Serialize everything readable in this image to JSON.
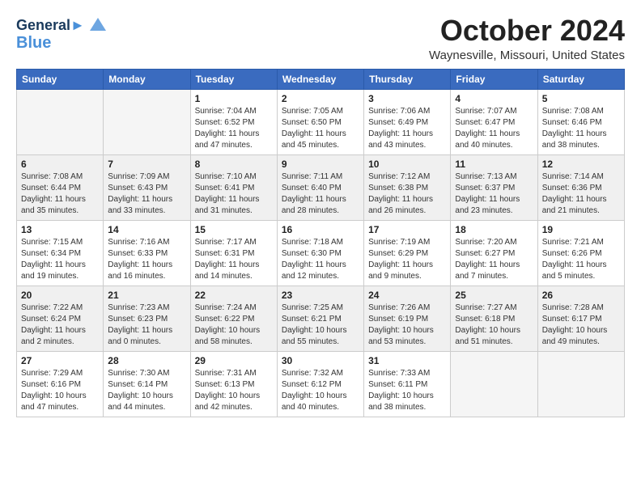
{
  "header": {
    "logo_line1": "General",
    "logo_line2": "Blue",
    "month": "October 2024",
    "location": "Waynesville, Missouri, United States"
  },
  "weekdays": [
    "Sunday",
    "Monday",
    "Tuesday",
    "Wednesday",
    "Thursday",
    "Friday",
    "Saturday"
  ],
  "weeks": [
    [
      {
        "day": "",
        "sunrise": "",
        "sunset": "",
        "daylight": "",
        "empty": true
      },
      {
        "day": "",
        "sunrise": "",
        "sunset": "",
        "daylight": "",
        "empty": true
      },
      {
        "day": "1",
        "sunrise": "Sunrise: 7:04 AM",
        "sunset": "Sunset: 6:52 PM",
        "daylight": "Daylight: 11 hours and 47 minutes.",
        "empty": false
      },
      {
        "day": "2",
        "sunrise": "Sunrise: 7:05 AM",
        "sunset": "Sunset: 6:50 PM",
        "daylight": "Daylight: 11 hours and 45 minutes.",
        "empty": false
      },
      {
        "day": "3",
        "sunrise": "Sunrise: 7:06 AM",
        "sunset": "Sunset: 6:49 PM",
        "daylight": "Daylight: 11 hours and 43 minutes.",
        "empty": false
      },
      {
        "day": "4",
        "sunrise": "Sunrise: 7:07 AM",
        "sunset": "Sunset: 6:47 PM",
        "daylight": "Daylight: 11 hours and 40 minutes.",
        "empty": false
      },
      {
        "day": "5",
        "sunrise": "Sunrise: 7:08 AM",
        "sunset": "Sunset: 6:46 PM",
        "daylight": "Daylight: 11 hours and 38 minutes.",
        "empty": false
      }
    ],
    [
      {
        "day": "6",
        "sunrise": "Sunrise: 7:08 AM",
        "sunset": "Sunset: 6:44 PM",
        "daylight": "Daylight: 11 hours and 35 minutes.",
        "empty": false
      },
      {
        "day": "7",
        "sunrise": "Sunrise: 7:09 AM",
        "sunset": "Sunset: 6:43 PM",
        "daylight": "Daylight: 11 hours and 33 minutes.",
        "empty": false
      },
      {
        "day": "8",
        "sunrise": "Sunrise: 7:10 AM",
        "sunset": "Sunset: 6:41 PM",
        "daylight": "Daylight: 11 hours and 31 minutes.",
        "empty": false
      },
      {
        "day": "9",
        "sunrise": "Sunrise: 7:11 AM",
        "sunset": "Sunset: 6:40 PM",
        "daylight": "Daylight: 11 hours and 28 minutes.",
        "empty": false
      },
      {
        "day": "10",
        "sunrise": "Sunrise: 7:12 AM",
        "sunset": "Sunset: 6:38 PM",
        "daylight": "Daylight: 11 hours and 26 minutes.",
        "empty": false
      },
      {
        "day": "11",
        "sunrise": "Sunrise: 7:13 AM",
        "sunset": "Sunset: 6:37 PM",
        "daylight": "Daylight: 11 hours and 23 minutes.",
        "empty": false
      },
      {
        "day": "12",
        "sunrise": "Sunrise: 7:14 AM",
        "sunset": "Sunset: 6:36 PM",
        "daylight": "Daylight: 11 hours and 21 minutes.",
        "empty": false
      }
    ],
    [
      {
        "day": "13",
        "sunrise": "Sunrise: 7:15 AM",
        "sunset": "Sunset: 6:34 PM",
        "daylight": "Daylight: 11 hours and 19 minutes.",
        "empty": false
      },
      {
        "day": "14",
        "sunrise": "Sunrise: 7:16 AM",
        "sunset": "Sunset: 6:33 PM",
        "daylight": "Daylight: 11 hours and 16 minutes.",
        "empty": false
      },
      {
        "day": "15",
        "sunrise": "Sunrise: 7:17 AM",
        "sunset": "Sunset: 6:31 PM",
        "daylight": "Daylight: 11 hours and 14 minutes.",
        "empty": false
      },
      {
        "day": "16",
        "sunrise": "Sunrise: 7:18 AM",
        "sunset": "Sunset: 6:30 PM",
        "daylight": "Daylight: 11 hours and 12 minutes.",
        "empty": false
      },
      {
        "day": "17",
        "sunrise": "Sunrise: 7:19 AM",
        "sunset": "Sunset: 6:29 PM",
        "daylight": "Daylight: 11 hours and 9 minutes.",
        "empty": false
      },
      {
        "day": "18",
        "sunrise": "Sunrise: 7:20 AM",
        "sunset": "Sunset: 6:27 PM",
        "daylight": "Daylight: 11 hours and 7 minutes.",
        "empty": false
      },
      {
        "day": "19",
        "sunrise": "Sunrise: 7:21 AM",
        "sunset": "Sunset: 6:26 PM",
        "daylight": "Daylight: 11 hours and 5 minutes.",
        "empty": false
      }
    ],
    [
      {
        "day": "20",
        "sunrise": "Sunrise: 7:22 AM",
        "sunset": "Sunset: 6:24 PM",
        "daylight": "Daylight: 11 hours and 2 minutes.",
        "empty": false
      },
      {
        "day": "21",
        "sunrise": "Sunrise: 7:23 AM",
        "sunset": "Sunset: 6:23 PM",
        "daylight": "Daylight: 11 hours and 0 minutes.",
        "empty": false
      },
      {
        "day": "22",
        "sunrise": "Sunrise: 7:24 AM",
        "sunset": "Sunset: 6:22 PM",
        "daylight": "Daylight: 10 hours and 58 minutes.",
        "empty": false
      },
      {
        "day": "23",
        "sunrise": "Sunrise: 7:25 AM",
        "sunset": "Sunset: 6:21 PM",
        "daylight": "Daylight: 10 hours and 55 minutes.",
        "empty": false
      },
      {
        "day": "24",
        "sunrise": "Sunrise: 7:26 AM",
        "sunset": "Sunset: 6:19 PM",
        "daylight": "Daylight: 10 hours and 53 minutes.",
        "empty": false
      },
      {
        "day": "25",
        "sunrise": "Sunrise: 7:27 AM",
        "sunset": "Sunset: 6:18 PM",
        "daylight": "Daylight: 10 hours and 51 minutes.",
        "empty": false
      },
      {
        "day": "26",
        "sunrise": "Sunrise: 7:28 AM",
        "sunset": "Sunset: 6:17 PM",
        "daylight": "Daylight: 10 hours and 49 minutes.",
        "empty": false
      }
    ],
    [
      {
        "day": "27",
        "sunrise": "Sunrise: 7:29 AM",
        "sunset": "Sunset: 6:16 PM",
        "daylight": "Daylight: 10 hours and 47 minutes.",
        "empty": false
      },
      {
        "day": "28",
        "sunrise": "Sunrise: 7:30 AM",
        "sunset": "Sunset: 6:14 PM",
        "daylight": "Daylight: 10 hours and 44 minutes.",
        "empty": false
      },
      {
        "day": "29",
        "sunrise": "Sunrise: 7:31 AM",
        "sunset": "Sunset: 6:13 PM",
        "daylight": "Daylight: 10 hours and 42 minutes.",
        "empty": false
      },
      {
        "day": "30",
        "sunrise": "Sunrise: 7:32 AM",
        "sunset": "Sunset: 6:12 PM",
        "daylight": "Daylight: 10 hours and 40 minutes.",
        "empty": false
      },
      {
        "day": "31",
        "sunrise": "Sunrise: 7:33 AM",
        "sunset": "Sunset: 6:11 PM",
        "daylight": "Daylight: 10 hours and 38 minutes.",
        "empty": false
      },
      {
        "day": "",
        "sunrise": "",
        "sunset": "",
        "daylight": "",
        "empty": true
      },
      {
        "day": "",
        "sunrise": "",
        "sunset": "",
        "daylight": "",
        "empty": true
      }
    ]
  ]
}
